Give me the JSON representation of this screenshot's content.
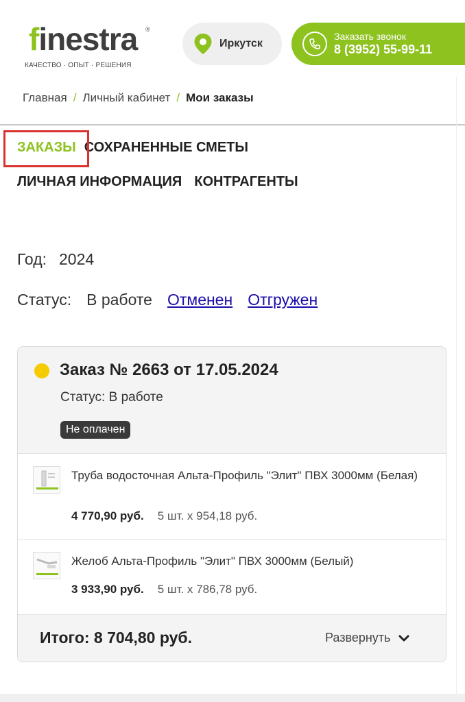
{
  "header": {
    "logo_word_f": "f",
    "logo_word_rest": "inestra",
    "logo_reg": "®",
    "logo_tagline": "КАЧЕСТВО · ОПЫТ · РЕШЕНИЯ",
    "city": "Иркутск",
    "call_label": "Заказать звонок",
    "call_phone": "8 (3952) 55-99-11",
    "colors": {
      "brand_green": "#8dc21f",
      "highlight_red": "#d9312b",
      "status_yellow": "#f5cc00"
    }
  },
  "breadcrumb": {
    "items": [
      "Главная",
      "Личный кабинет"
    ],
    "current": "Мои заказы",
    "separator": "/"
  },
  "tabs": {
    "orders": "ЗАКАЗЫ",
    "saved_estimates": "СОХРАНЕННЫЕ СМЕТЫ",
    "personal_info": "ЛИЧНАЯ ИНФОРМАЦИЯ",
    "contractors": "КОНТРАГЕНТЫ",
    "active": "orders"
  },
  "filters": {
    "year_label": "Год:",
    "year_value": "2024",
    "status_label": "Статус:",
    "status_current": "В работе",
    "status_links": [
      "Отменен",
      "Отгружен"
    ]
  },
  "order": {
    "title": "Заказ № 2663 от 17.05.2024",
    "status": "Статус: В работе",
    "payment_badge": "Не оплачен",
    "items": [
      {
        "name": "Труба водосточная Альта-Профиль \"Элит\" ПВХ 3000мм (Белая)",
        "price": "4 770,90 руб.",
        "qty": "5 шт. x 954,18 руб.",
        "icon": "pipe-thumbnail-icon"
      },
      {
        "name": "Желоб Альта-Профиль \"Элит\" ПВХ 3000мм (Белый)",
        "price": "3 933,90 руб.",
        "qty": "5 шт. x 786,78 руб.",
        "icon": "gutter-thumbnail-icon"
      }
    ],
    "total": "Итого: 8 704,80 руб.",
    "expand_label": "Развернуть"
  }
}
